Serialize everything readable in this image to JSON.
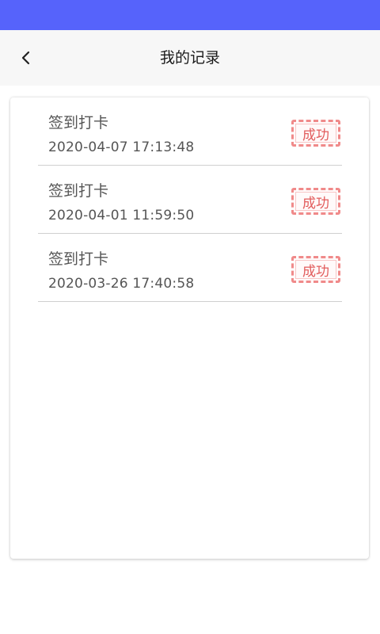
{
  "status_bar": {
    "color": "#5663fb"
  },
  "nav": {
    "back_icon": "chevron-left-icon",
    "title": "我的记录"
  },
  "records": [
    {
      "title": "签到打卡",
      "time": "2020-04-07 17:13:48",
      "status": "成功"
    },
    {
      "title": "签到打卡",
      "time": "2020-04-01 11:59:50",
      "status": "成功"
    },
    {
      "title": "签到打卡",
      "time": "2020-03-26 17:40:58",
      "status": "成功"
    }
  ],
  "colors": {
    "accent": "#5663fb",
    "stamp": "#e25c5c"
  }
}
